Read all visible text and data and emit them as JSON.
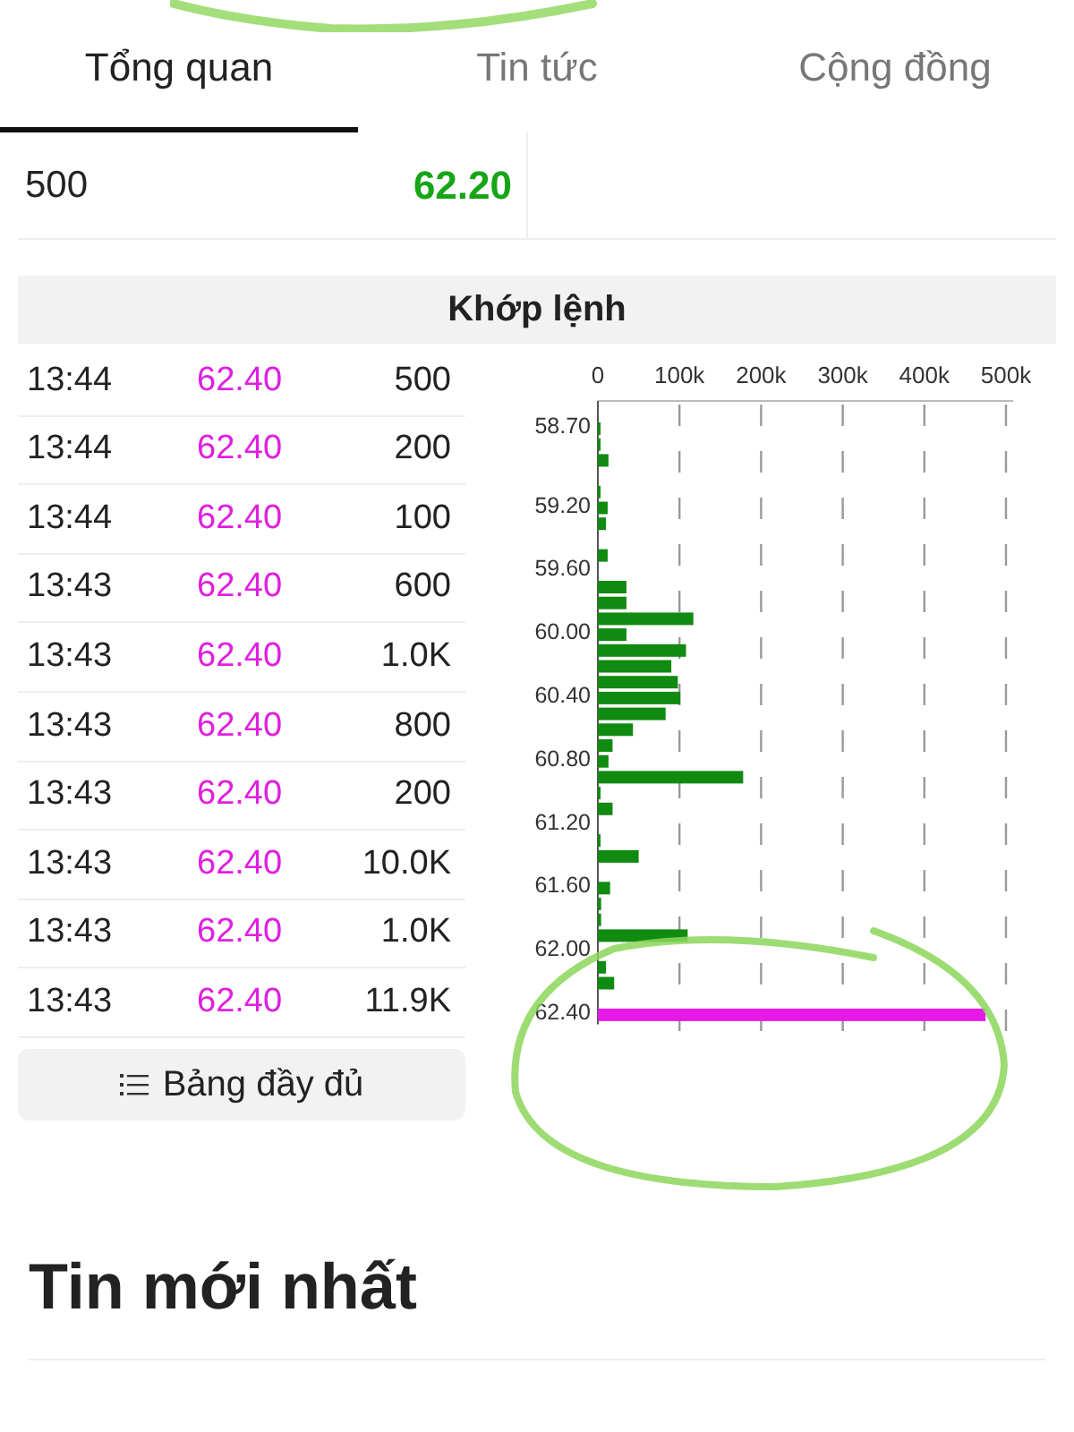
{
  "tabs": [
    {
      "label": "Tổng quan",
      "selected": true
    },
    {
      "label": "Tin tức",
      "selected": false
    },
    {
      "label": "Cộng đồng",
      "selected": false
    }
  ],
  "order_row": {
    "volume": "500",
    "price": "62.20"
  },
  "matches": {
    "title": "Khớp lệnh",
    "rows": [
      {
        "time": "13:44",
        "price": "62.40",
        "volume": "500"
      },
      {
        "time": "13:44",
        "price": "62.40",
        "volume": "200"
      },
      {
        "time": "13:44",
        "price": "62.40",
        "volume": "100"
      },
      {
        "time": "13:43",
        "price": "62.40",
        "volume": "600"
      },
      {
        "time": "13:43",
        "price": "62.40",
        "volume": "1.0K"
      },
      {
        "time": "13:43",
        "price": "62.40",
        "volume": "800"
      },
      {
        "time": "13:43",
        "price": "62.40",
        "volume": "200"
      },
      {
        "time": "13:43",
        "price": "62.40",
        "volume": "10.0K"
      },
      {
        "time": "13:43",
        "price": "62.40",
        "volume": "1.0K"
      },
      {
        "time": "13:43",
        "price": "62.40",
        "volume": "11.9K"
      }
    ],
    "full_table_button": "Bảng đầy đủ",
    "chart_data": {
      "type": "bar",
      "orientation": "horizontal",
      "grid": true,
      "xlim": [
        0,
        500
      ],
      "categories": [
        "58.70",
        null,
        null,
        null,
        null,
        "59.20",
        null,
        null,
        null,
        "59.60",
        null,
        null,
        null,
        "60.00",
        null,
        null,
        null,
        "60.40",
        null,
        null,
        null,
        "60.80",
        null,
        null,
        null,
        "61.20",
        null,
        null,
        null,
        "61.60",
        null,
        null,
        null,
        "62.00",
        null,
        null,
        null,
        "62.40"
      ],
      "xticks": [
        {
          "value": 0,
          "label": "0"
        },
        {
          "value": 100,
          "label": "100k"
        },
        {
          "value": 200,
          "label": "200k"
        },
        {
          "value": 300,
          "label": "300k"
        },
        {
          "value": 400,
          "label": "400k"
        },
        {
          "value": 500,
          "label": "500k"
        }
      ],
      "series": [
        {
          "color": "#118a11",
          "values": [
            3,
            2,
            13,
            0,
            2,
            12,
            10,
            0,
            12,
            0,
            35,
            35,
            117,
            35,
            108,
            90,
            98,
            101,
            83,
            43,
            18,
            13,
            178,
            2,
            18,
            0,
            2,
            50,
            0,
            15,
            4,
            4,
            110,
            0,
            10,
            20,
            0,
            null
          ]
        },
        {
          "color": "#e619e6",
          "values": [
            null,
            null,
            null,
            null,
            null,
            null,
            null,
            null,
            null,
            null,
            null,
            null,
            null,
            null,
            null,
            null,
            null,
            null,
            null,
            null,
            null,
            null,
            null,
            null,
            null,
            null,
            null,
            null,
            null,
            null,
            null,
            null,
            null,
            null,
            null,
            null,
            null,
            475
          ]
        }
      ]
    }
  },
  "latest_news": {
    "title": "Tin mới nhất"
  }
}
